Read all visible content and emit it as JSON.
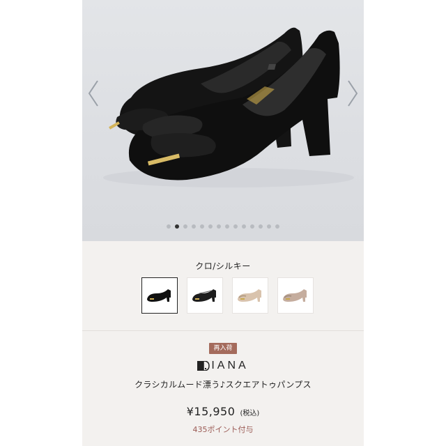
{
  "gallery": {
    "image_icon": "black-suede-bow-pump-pair",
    "prev_icon": "chevron-left-icon",
    "next_icon": "chevron-right-icon",
    "dot_count": 14,
    "active_dot": 1,
    "background": "#dfe1e5"
  },
  "product": {
    "selected_color": "クロ/シルキー",
    "swatches": [
      {
        "icon": "black-suede-pump",
        "color": "#111111",
        "active": true
      },
      {
        "icon": "black-leather-pump",
        "color": "#1a1a1a",
        "active": false
      },
      {
        "icon": "beige-pump",
        "color": "#d9c3ad",
        "active": false
      },
      {
        "icon": "greige-pump",
        "color": "#c5ad9e",
        "active": false
      }
    ],
    "badge": "再入荷",
    "brand": "IANA",
    "name": "クラシカルムード漂う♪スクエアトゥパンプス",
    "price": "¥15,950",
    "tax_label": "(税込)",
    "points": "435ポイント付与"
  },
  "colors": {
    "panel_bg": "#f3f1ef",
    "badge_bg": "#a46b5c",
    "points_text": "#9b5b55"
  }
}
